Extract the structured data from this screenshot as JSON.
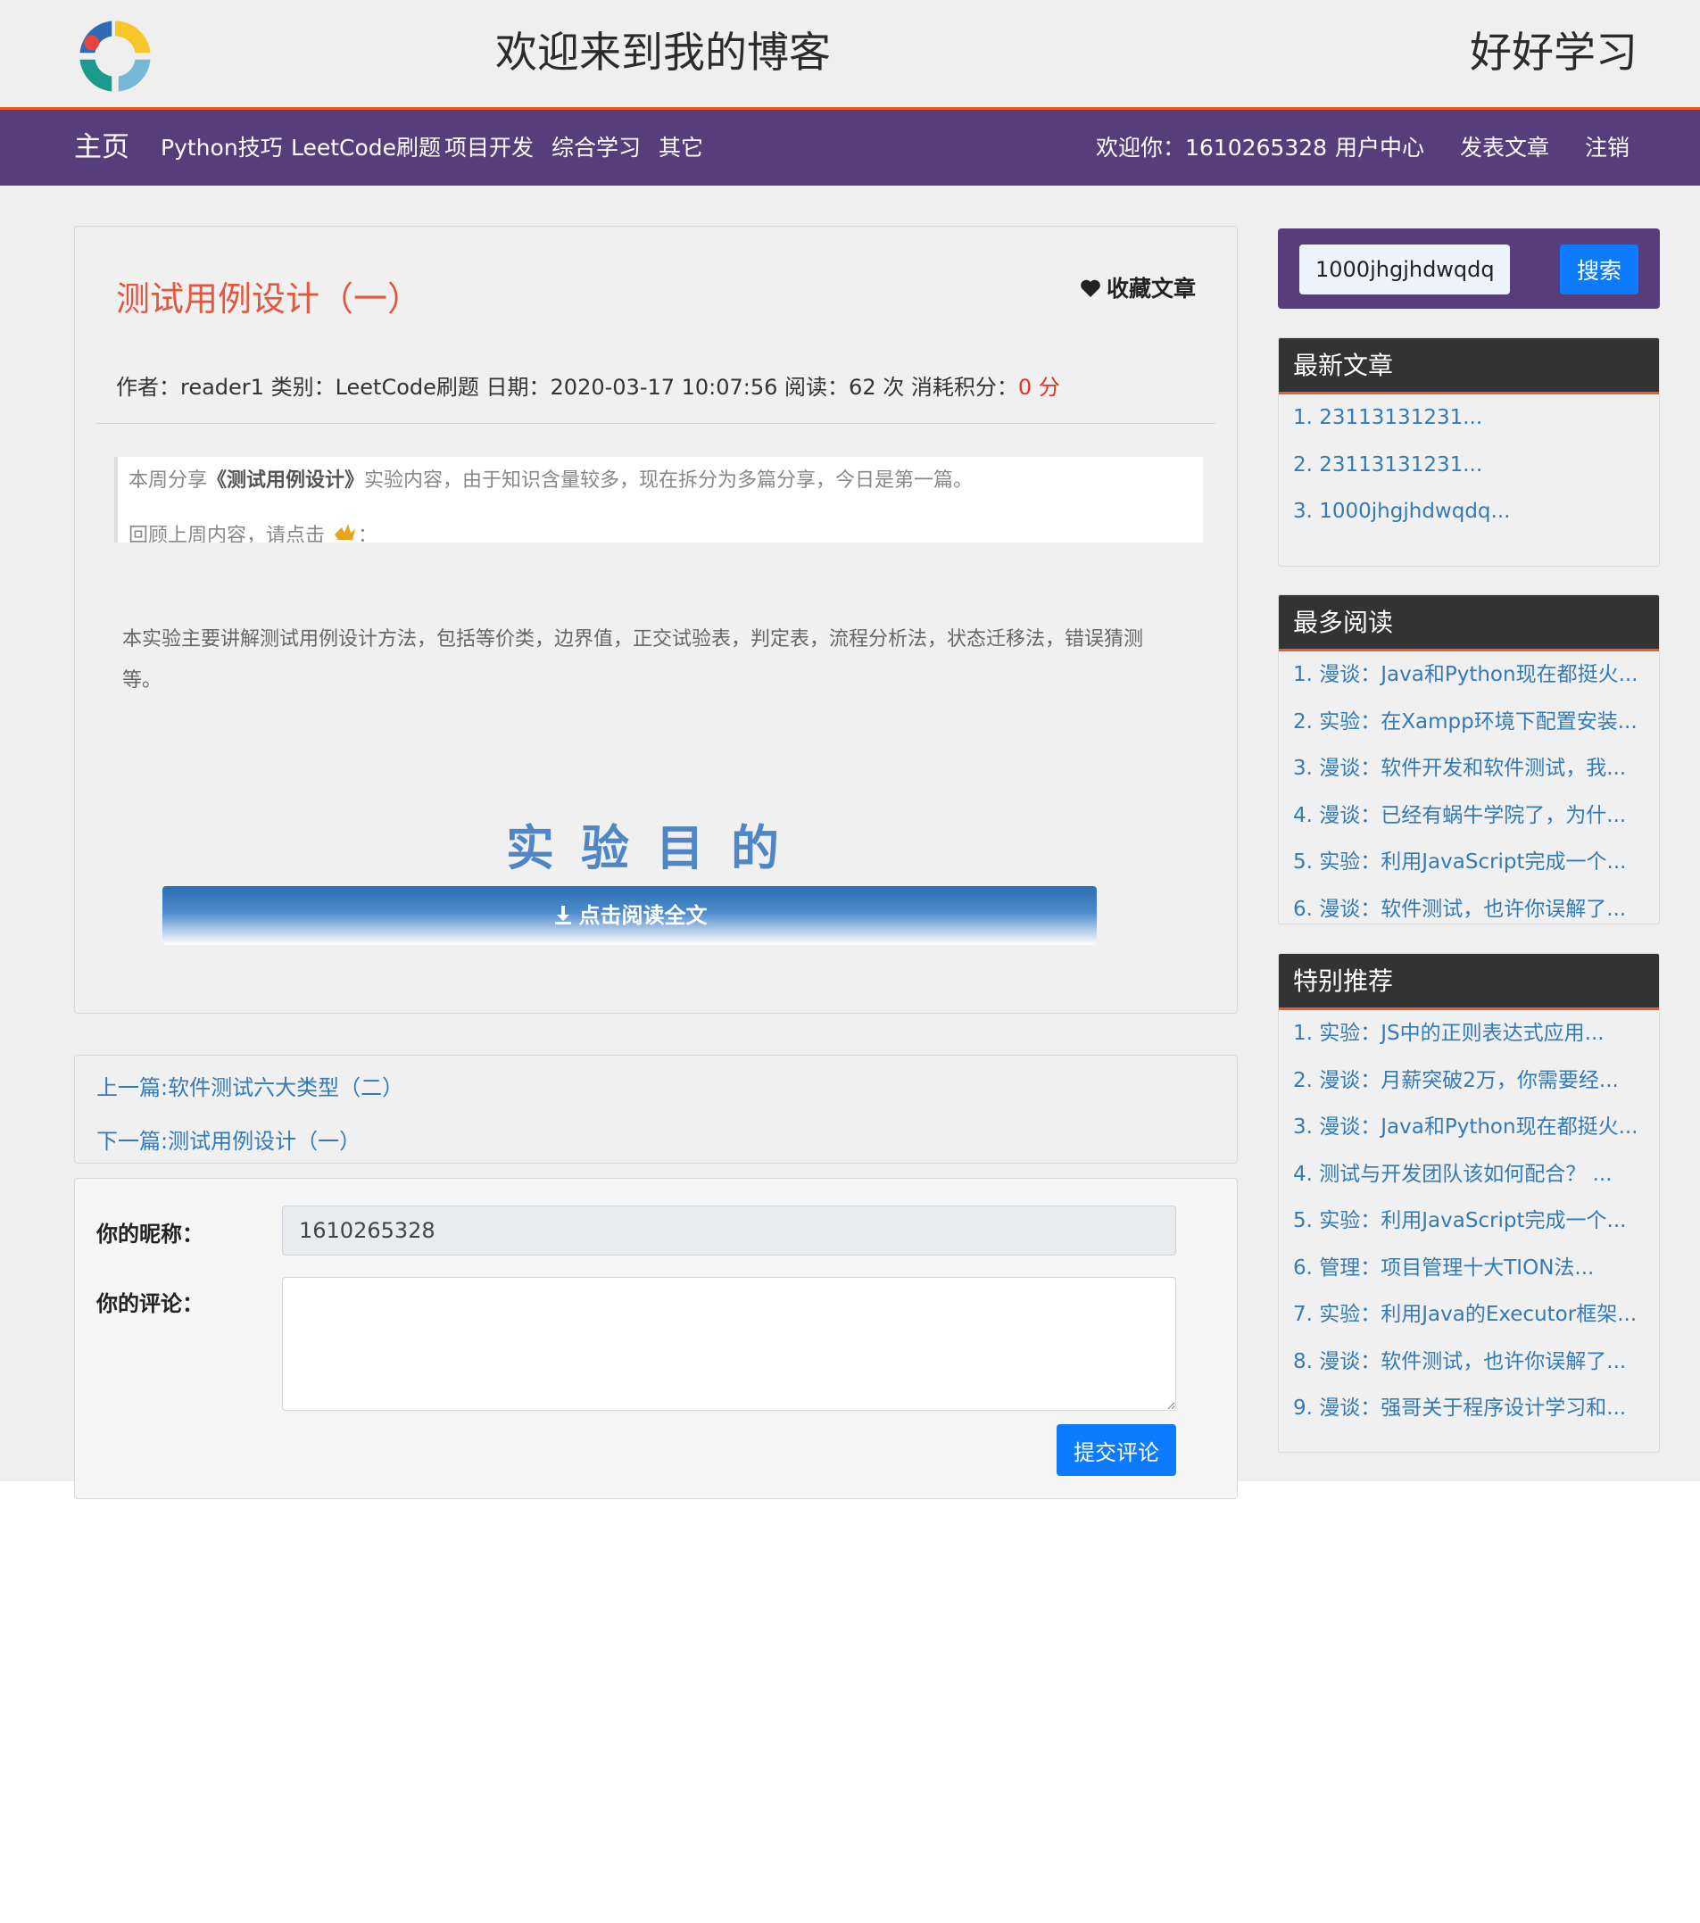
{
  "header": {
    "logo": "logo",
    "site_title": "欢迎来到我的博客",
    "slogan": "好好学习"
  },
  "nav": {
    "brand": "主页",
    "items": [
      "Python技巧",
      "LeetCode刷题",
      "项目开发",
      "综合学习",
      "其它"
    ],
    "welcome": "欢迎你：1610265328",
    "user_center": "用户中心",
    "post_article": "发表文章",
    "logout": "注销"
  },
  "article": {
    "title": "测试用例设计（一）",
    "favorite_label": "收藏文章",
    "meta_text": "作者：reader1 类别：LeetCode刷题 日期：2020-03-17 10:07:56 阅读：62 次 消耗积分：",
    "cost": "0 分",
    "quote_prefix": "本周分享",
    "quote_bold": "《测试用例设计》",
    "quote_suffix": "实验内容，由于知识含量较多，现在拆分为多篇分享，今日是第一篇。",
    "quote_line2": "回顾上周内容，请点击",
    "quote_line2_end": "：",
    "intro": "本实验主要讲解测试用例设计方法，包括等价类，边界值，正交试验表，判定表，流程分析法，状态迁移法，错误猜测等。",
    "section_heading": "实验目的",
    "read_all": "点击阅读全文"
  },
  "pager": {
    "prev": "上一篇:软件测试六大类型（二）",
    "next": "下一篇:测试用例设计（一）"
  },
  "comment": {
    "nickname_label": "你的昵称：",
    "nickname_value": "1610265328",
    "comment_label": "你的评论：",
    "comment_value": "",
    "submit_label": "提交评论"
  },
  "sidebar": {
    "search_value": "1000jhgjhdwqdq",
    "search_button": "搜索",
    "latest_title": "最新文章",
    "latest": [
      "1. 23113131231...",
      "2. 23113131231...",
      "3. 1000jhgjhdwqdq..."
    ],
    "most_read_title": "最多阅读",
    "most_read": [
      "1. 漫谈：Java和Python现在都挺火...",
      "2. 实验：在Xampp环境下配置安装...",
      "3. 漫谈：软件开发和软件测试，我...",
      "4. 漫谈：已经有蜗牛学院了，为什...",
      "5. 实验：利用JavaScript完成一个...",
      "6. 漫谈：软件测试，也许你误解了..."
    ],
    "recommend_title": "特别推荐",
    "recommend": [
      "1. 实验：JS中的正则表达式应用...",
      "2. 漫谈：月薪突破2万，你需要经...",
      "3. 漫谈：Java和Python现在都挺火...",
      "4. 测试与开发团队该如何配合？ ...",
      "5. 实验：利用JavaScript完成一个...",
      "6. 管理：项目管理十大TION法...",
      "7. 实验：利用Java的Executor框架...",
      "8. 漫谈：软件测试，也许你误解了...",
      "9. 漫谈：强哥关于程序设计学习和..."
    ]
  },
  "colors": {
    "nav_bg": "#563d7c",
    "accent_orange": "#f05a28",
    "title_red": "#e2583e",
    "link_blue": "#337ab7",
    "button_blue": "#0d7bff",
    "panel_header": "#333333"
  }
}
